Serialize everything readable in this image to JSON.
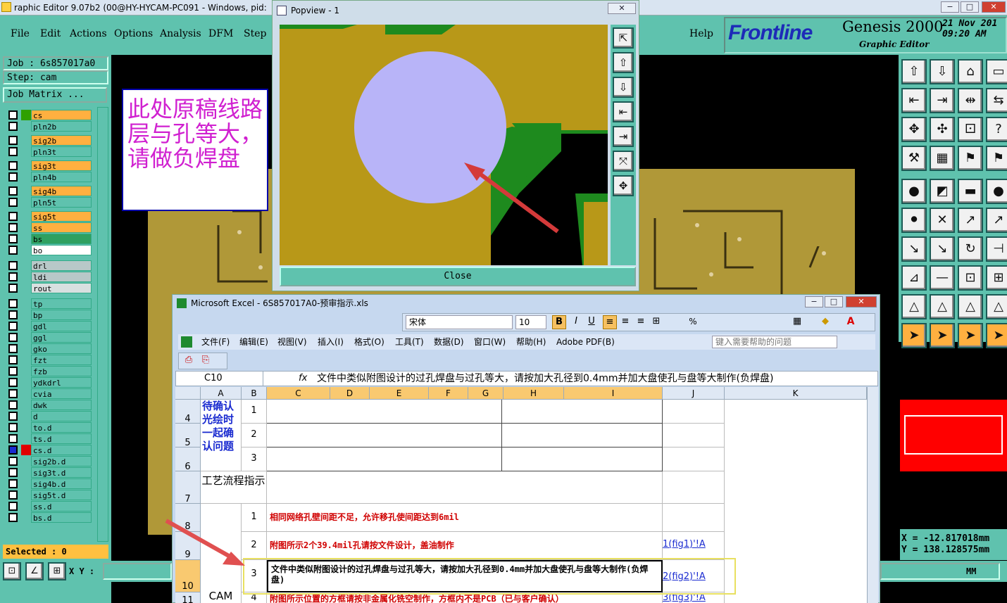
{
  "genesis": {
    "window_title": "raphic Editor 9.07b2 (00@HY-HYCAM-PC091 - Windows, pid:",
    "menu": [
      "File",
      "Edit",
      "Actions",
      "Options",
      "Analysis",
      "DFM",
      "Step"
    ],
    "help": "Help",
    "brand": "Frontline",
    "product": "Genesis 2000",
    "subtitle": "Graphic Editor",
    "date": "21 Nov 201",
    "time": "09:20 AM",
    "job": "Job : 6s857017a0",
    "step": "Step: cam",
    "job_matrix": "Job Matrix ...",
    "selected": "Selected : 0",
    "xy_label": "X Y :",
    "units": "MM",
    "coords": {
      "x": "X = -12.817018mm",
      "y": "Y = 138.128575mm"
    },
    "note": "此处原稿线路层与孔等大，请做负焊盘",
    "layers": [
      {
        "name": "cs",
        "color": "#ffb040",
        "swatch": "#2fa000",
        "on": false
      },
      {
        "name": "pln2b",
        "color": "#5fc2ae",
        "swatch": "#5fc2ae",
        "on": false
      },
      {
        "name": "sig2b",
        "color": "#ffb040",
        "swatch": "#5fc2ae",
        "on": false
      },
      {
        "name": "pln3t",
        "color": "#5fc2ae",
        "swatch": "#5fc2ae",
        "on": false
      },
      {
        "name": "sig3t",
        "color": "#ffb040",
        "swatch": "#5fc2ae",
        "on": false
      },
      {
        "name": "pln4b",
        "color": "#5fc2ae",
        "swatch": "#5fc2ae",
        "on": false
      },
      {
        "name": "sig4b",
        "color": "#ffb040",
        "swatch": "#5fc2ae",
        "on": false
      },
      {
        "name": "pln5t",
        "color": "#5fc2ae",
        "swatch": "#5fc2ae",
        "on": false
      },
      {
        "name": "sig5t",
        "color": "#ffb040",
        "swatch": "#5fc2ae",
        "on": false
      },
      {
        "name": "ss",
        "color": "#ffb040",
        "swatch": "#5fc2ae",
        "on": false
      },
      {
        "name": "bs",
        "color": "#2fa060",
        "swatch": "#5fc2ae",
        "on": false
      },
      {
        "name": "bo",
        "color": "#ffffff",
        "swatch": "#5fc2ae",
        "on": false
      },
      {
        "name": "drl",
        "color": "#b8c8c8",
        "swatch": "#5fc2ae",
        "on": false
      },
      {
        "name": "ldi",
        "color": "#b8c8c8",
        "swatch": "#5fc2ae",
        "on": false
      },
      {
        "name": "rout",
        "color": "#d8e0e0",
        "swatch": "#5fc2ae",
        "on": false
      },
      {
        "name": "tp",
        "color": "#5fc2ae",
        "swatch": "#5fc2ae",
        "on": false
      },
      {
        "name": "bp",
        "color": "#5fc2ae",
        "swatch": "#5fc2ae",
        "on": false
      },
      {
        "name": "gdl",
        "color": "#5fc2ae",
        "swatch": "#5fc2ae",
        "on": false
      },
      {
        "name": "ggl",
        "color": "#5fc2ae",
        "swatch": "#5fc2ae",
        "on": false
      },
      {
        "name": "gko",
        "color": "#5fc2ae",
        "swatch": "#5fc2ae",
        "on": false
      },
      {
        "name": "fzt",
        "color": "#5fc2ae",
        "swatch": "#5fc2ae",
        "on": false
      },
      {
        "name": "fzb",
        "color": "#5fc2ae",
        "swatch": "#5fc2ae",
        "on": false
      },
      {
        "name": "ydkdrl",
        "color": "#5fc2ae",
        "swatch": "#5fc2ae",
        "on": false
      },
      {
        "name": "cvia",
        "color": "#5fc2ae",
        "swatch": "#5fc2ae",
        "on": false
      },
      {
        "name": "dwk",
        "color": "#5fc2ae",
        "swatch": "#5fc2ae",
        "on": false
      },
      {
        "name": "d",
        "color": "#5fc2ae",
        "swatch": "#5fc2ae",
        "on": false
      },
      {
        "name": "to.d",
        "color": "#5fc2ae",
        "swatch": "#5fc2ae",
        "on": false
      },
      {
        "name": "ts.d",
        "color": "#5fc2ae",
        "swatch": "#5fc2ae",
        "on": false
      },
      {
        "name": "cs.d",
        "color": "#5fc2ae",
        "swatch": "#e00000",
        "on": true
      },
      {
        "name": "sig2b.d",
        "color": "#5fc2ae",
        "swatch": "#5fc2ae",
        "on": false
      },
      {
        "name": "sig3t.d",
        "color": "#5fc2ae",
        "swatch": "#5fc2ae",
        "on": false
      },
      {
        "name": "sig4b.d",
        "color": "#5fc2ae",
        "swatch": "#5fc2ae",
        "on": false
      },
      {
        "name": "sig5t.d",
        "color": "#5fc2ae",
        "swatch": "#5fc2ae",
        "on": false
      },
      {
        "name": "ss.d",
        "color": "#5fc2ae",
        "swatch": "#5fc2ae",
        "on": false
      },
      {
        "name": "bs.d",
        "color": "#5fc2ae",
        "swatch": "#5fc2ae",
        "on": false
      }
    ]
  },
  "popview": {
    "title": "Popview - 1",
    "close_label": "Close"
  },
  "excel": {
    "title": "Microsoft Excel - 6S857017A0-预审指示.xls",
    "font_name": "宋体",
    "font_size": "10",
    "menu": [
      "文件(F)",
      "编辑(E)",
      "视图(V)",
      "插入(I)",
      "格式(O)",
      "工具(T)",
      "数据(D)",
      "窗口(W)",
      "帮助(H)",
      "Adobe PDF(B)"
    ],
    "help_placeholder": "键入需要帮助的问题",
    "cell_ref": "C10",
    "formula": "文件中类似附图设计的过孔焊盘与过孔等大，请按加大孔径到0.4mm并加大盘使孔与盘等大制作(负焊盘)",
    "columns": [
      "A",
      "B",
      "C",
      "D",
      "E",
      "F",
      "G",
      "H",
      "I",
      "J",
      "K"
    ],
    "rows": {
      "r4": "4",
      "r5": "5",
      "r6": "6",
      "r7": "7",
      "r8": "8",
      "r9": "9",
      "r10": "10",
      "r11": "11",
      "a_confirm": "待确认光绘时一起确认问题",
      "a_process": "工艺流程指示",
      "a_cam": "CAM",
      "b1": "1",
      "b2": "2",
      "b3": "3",
      "p1": "1",
      "p2": "2",
      "p3": "3",
      "p4": "4",
      "t1": "相同网络孔壁间距不足，允许移孔使间距达到6mil",
      "t2": "附图所示2个39.4mil孔请按文件设计，盖油制作",
      "t3": "文件中类似附图设计的过孔焊盘与过孔等大，请按加大孔径到0.4mm并加大盘使孔与盘等大制作(负焊盘)",
      "t4": "附图所示位置的方框请按非金属化铣空制作，方框内不是PCB（已与客户确认）",
      "l1": "1(fig1)'!A",
      "l2": "2(fig2)'!A",
      "l3": "3(fig3)'!A"
    }
  }
}
